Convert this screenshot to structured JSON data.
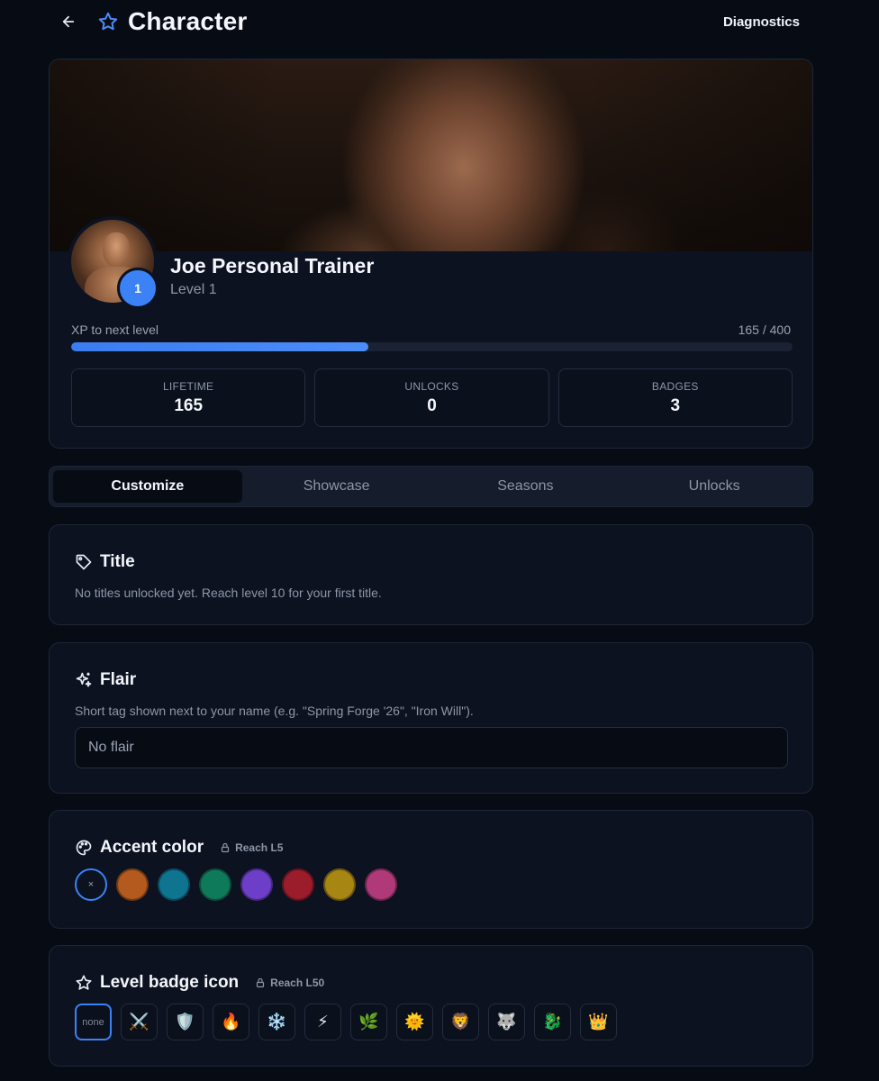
{
  "header": {
    "title": "Character",
    "diagnostics_label": "Diagnostics"
  },
  "profile": {
    "name": "Joe Personal Trainer",
    "level_label": "Level 1",
    "level_number": "1",
    "xp_label": "XP to next level",
    "xp_value": "165 / 400",
    "xp_progress_percent": 41.25,
    "stats": [
      {
        "label": "LIFETIME",
        "value": "165"
      },
      {
        "label": "UNLOCKS",
        "value": "0"
      },
      {
        "label": "BADGES",
        "value": "3"
      }
    ]
  },
  "tabs": [
    {
      "label": "Customize",
      "active": true
    },
    {
      "label": "Showcase",
      "active": false
    },
    {
      "label": "Seasons",
      "active": false
    },
    {
      "label": "Unlocks",
      "active": false
    }
  ],
  "title_section": {
    "heading": "Title",
    "description": "No titles unlocked yet. Reach level 10 for your first title."
  },
  "flair_section": {
    "heading": "Flair",
    "description": "Short tag shown next to your name (e.g. \"Spring Forge '26\", \"Iron Will\").",
    "placeholder": "No flair"
  },
  "accent_section": {
    "heading": "Accent color",
    "lock_label": "Reach L5",
    "none_symbol": "×",
    "colors": [
      "#b45a1e",
      "#0e7490",
      "#0f7a5a",
      "#6d3fc8",
      "#9b1c2a",
      "#a88614",
      "#b03a79"
    ]
  },
  "badge_section": {
    "heading": "Level badge icon",
    "lock_label": "Reach L50",
    "none_label": "none",
    "icons": [
      {
        "name": "crossed-swords",
        "glyph": "⚔️"
      },
      {
        "name": "shield",
        "glyph": "🛡️"
      },
      {
        "name": "fire",
        "glyph": "🔥"
      },
      {
        "name": "snowflake",
        "glyph": "❄️"
      },
      {
        "name": "lightning",
        "glyph": "⚡"
      },
      {
        "name": "herb",
        "glyph": "🌿"
      },
      {
        "name": "sun",
        "glyph": "🌞"
      },
      {
        "name": "lion",
        "glyph": "🦁"
      },
      {
        "name": "wolf",
        "glyph": "🐺"
      },
      {
        "name": "dragon",
        "glyph": "🐉"
      },
      {
        "name": "crown",
        "glyph": "👑"
      }
    ]
  },
  "colors": {
    "accent": "#3b82f6",
    "background": "#070b14",
    "card": "#0c1220"
  }
}
